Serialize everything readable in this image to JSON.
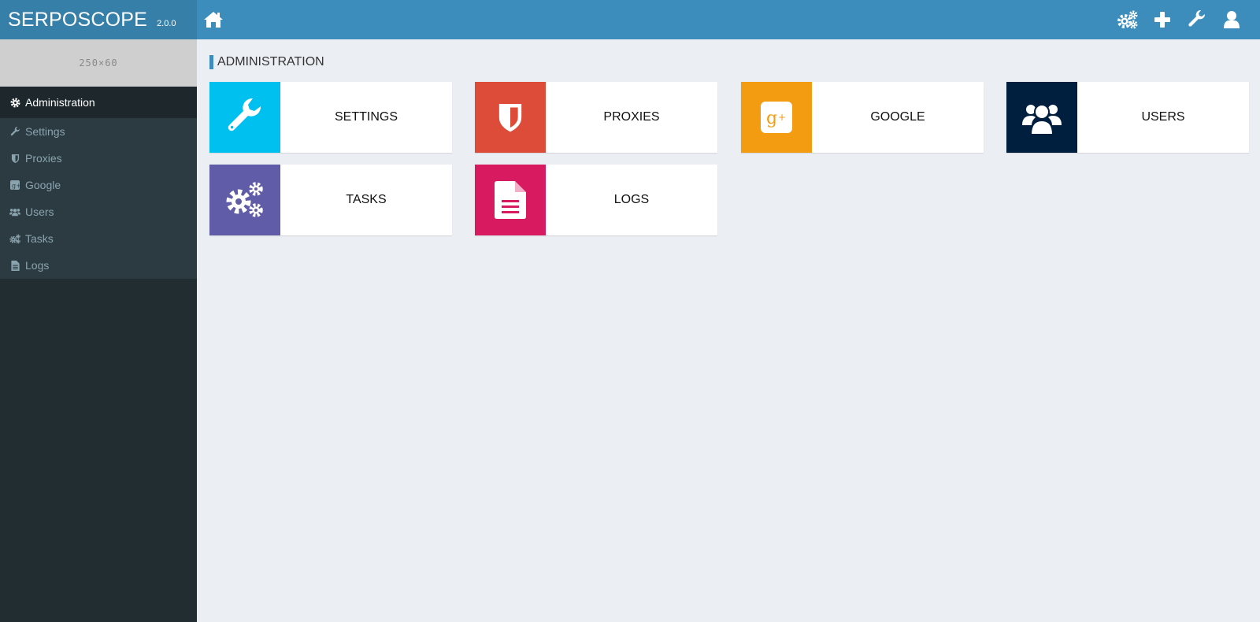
{
  "app": {
    "name": "SERPOSCOPE",
    "version": "2.0.0"
  },
  "logo_placeholder": "250×60",
  "header": {
    "icons": [
      "home-icon",
      "gears-icon",
      "plus-icon",
      "wrench-icon",
      "user-icon"
    ]
  },
  "sidebar": {
    "items": [
      {
        "label": "Administration",
        "icon": "gear-icon",
        "active": true
      },
      {
        "label": "Settings",
        "icon": "wrench-icon"
      },
      {
        "label": "Proxies",
        "icon": "shield-icon"
      },
      {
        "label": "Google",
        "icon": "google-plus-icon"
      },
      {
        "label": "Users",
        "icon": "users-icon"
      },
      {
        "label": "Tasks",
        "icon": "gears-icon"
      },
      {
        "label": "Logs",
        "icon": "file-icon"
      }
    ]
  },
  "main": {
    "title": "ADMINISTRATION",
    "tiles": [
      {
        "label": "SETTINGS",
        "icon": "wrench-icon",
        "color": "#00c0ef"
      },
      {
        "label": "PROXIES",
        "icon": "shield-icon",
        "color": "#dd4b39"
      },
      {
        "label": "GOOGLE",
        "icon": "google-plus-icon",
        "color": "#f39c12"
      },
      {
        "label": "USERS",
        "icon": "users-icon",
        "color": "#001f3f"
      },
      {
        "label": "TASKS",
        "icon": "gears-icon",
        "color": "#605ca8"
      },
      {
        "label": "LOGS",
        "icon": "file-icon",
        "color": "#d81b60"
      }
    ]
  }
}
